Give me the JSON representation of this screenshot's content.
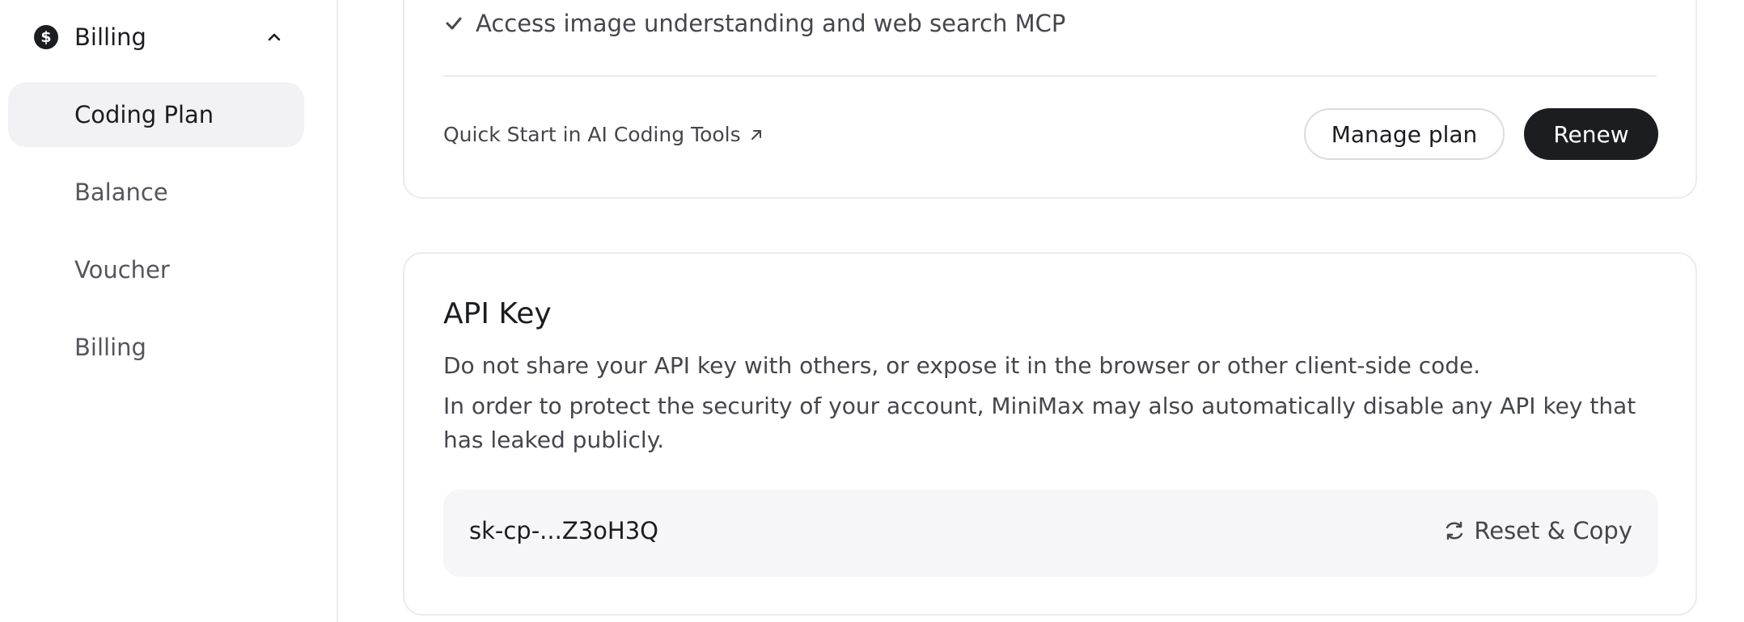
{
  "sidebar": {
    "section_title": "Billing",
    "section_icon": "dollar-coin-icon",
    "items": [
      {
        "label": "Coding Plan",
        "active": true
      },
      {
        "label": "Balance",
        "active": false
      },
      {
        "label": "Voucher",
        "active": false
      },
      {
        "label": "Billing",
        "active": false
      }
    ]
  },
  "plan_card": {
    "feature": "Access image understanding and web search MCP",
    "quick_start": "Quick Start in AI Coding Tools",
    "manage_label": "Manage plan",
    "renew_label": "Renew"
  },
  "api_card": {
    "title": "API Key",
    "desc1": "Do not share your API key with others, or expose it in the browser or other client-side code.",
    "desc2": "In order to protect the security of your account, MiniMax may also automatically disable any API key that has leaked publicly.",
    "key_value": "sk-cp-...Z3oH3Q",
    "reset_copy_label": "Reset & Copy"
  },
  "colors": {
    "primary_dark": "#1c1d21",
    "active_bg": "#f2f2f4",
    "key_bg": "#f6f6f8",
    "border": "#ececee"
  }
}
